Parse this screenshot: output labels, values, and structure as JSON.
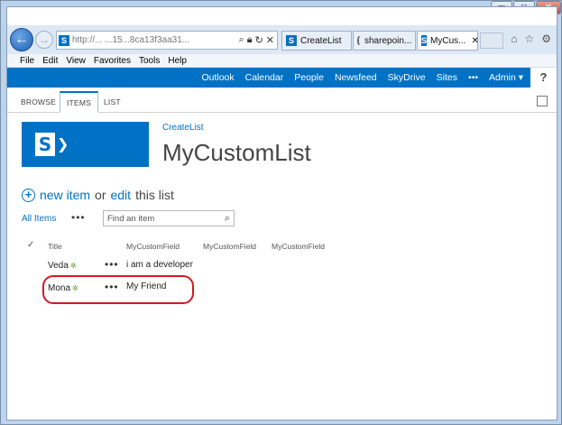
{
  "browser": {
    "window_controls": {
      "minimize": "▭",
      "maximize": "□",
      "close": "✕"
    },
    "address": {
      "text": "http://...   ...15...8ca13f3aa31..."
    },
    "address_icons": [
      "search-icon",
      "lock-icon",
      "refresh-icon",
      "stop-icon"
    ],
    "tabs": [
      {
        "label": "CreateList",
        "state": "normal"
      },
      {
        "label": "sharepoin...",
        "state": "loading"
      },
      {
        "label": "MyCus...",
        "state": "active",
        "close": "✕"
      }
    ],
    "toolbar_icons": [
      "home-icon",
      "favorites-star-icon",
      "settings-gear-icon"
    ],
    "menu": [
      "File",
      "Edit",
      "View",
      "Favorites",
      "Tools",
      "Help"
    ]
  },
  "suitebar": {
    "items": [
      "Outlook",
      "Calendar",
      "People",
      "Newsfeed",
      "SkyDrive",
      "Sites"
    ],
    "more": "•••",
    "admin": "Admin ▾",
    "help": "?"
  },
  "ribbon": {
    "tabs": [
      "BROWSE",
      "ITEMS",
      "LIST"
    ],
    "active": "ITEMS"
  },
  "site": {
    "breadcrumb": "CreateList",
    "title": "MyCustomList",
    "logo_letter": "S"
  },
  "list": {
    "new_item": "new item",
    "or": "or",
    "edit": "edit",
    "this_list": "this list",
    "view": "All Items",
    "view_more": "•••",
    "search_placeholder": "Find an item",
    "check_mark": "✓",
    "headers": [
      "Title",
      "MyCustomField",
      "MyCustomField",
      "MyCustomField"
    ],
    "rows": [
      {
        "title": "Veda",
        "field1": "i am a developer",
        "more": "•••",
        "new_badge": "✲"
      },
      {
        "title": "Mona",
        "field1": "My Friend",
        "more": "•••",
        "new_badge": "✲"
      }
    ]
  },
  "colors": {
    "accent": "#0072c6",
    "highlight": "#d11a20",
    "new_badge": "#56a01b"
  }
}
